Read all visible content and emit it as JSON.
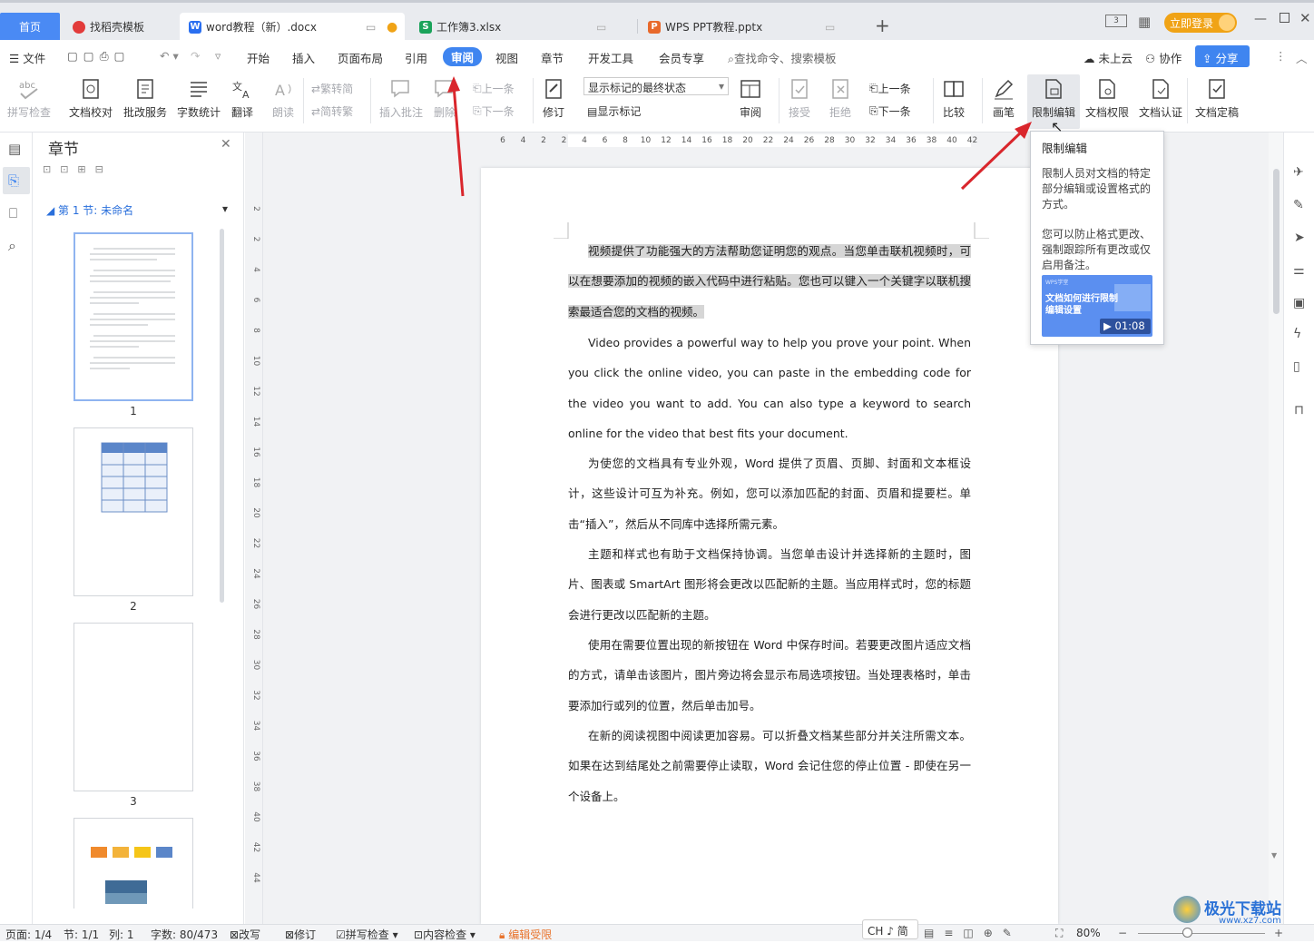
{
  "tabs": {
    "home": "首页",
    "t1": "找稻壳模板",
    "t2": "word教程（新）.docx",
    "t3": "工作簿3.xlsx",
    "t4": "WPS PPT教程.pptx",
    "login": "立即登录"
  },
  "menu": {
    "file": "文件",
    "items": [
      "开始",
      "插入",
      "页面布局",
      "引用",
      "审阅",
      "视图",
      "章节",
      "开发工具",
      "会员专享"
    ],
    "search": "查找命令、搜索模板",
    "cloud": "未上云",
    "collab": "协作",
    "share": "分享"
  },
  "ribbon": {
    "spell": "拼写检查",
    "proof": "文档校对",
    "batch": "批改服务",
    "wordcount": "字数统计",
    "translate": "翻译",
    "read": "朗读",
    "trad": "繁转简",
    "simp": "简转繁",
    "insert_comment": "插入批注",
    "delete": "删除",
    "prev": "上一条",
    "next": "下一条",
    "track": "修订",
    "markup_select": "显示标记的最终状态",
    "show_markup": "显示标记",
    "review": "审阅",
    "accept": "接受",
    "reject": "拒绝",
    "prev2": "上一条",
    "next2": "下一条",
    "compare": "比较",
    "pen": "画笔",
    "restrict": "限制编辑",
    "permission": "文档权限",
    "certify": "文档认证",
    "finalize": "文档定稿"
  },
  "nav": {
    "title": "章节",
    "section": "第 1 节: 未命名",
    "pages": [
      "1",
      "2",
      "3"
    ]
  },
  "ruler": [
    "6",
    "4",
    "2",
    "2",
    "4",
    "6",
    "8",
    "10",
    "12",
    "14",
    "16",
    "18",
    "20",
    "22",
    "24",
    "26",
    "28",
    "30",
    "32",
    "34",
    "36",
    "38",
    "40",
    "42"
  ],
  "vruler": [
    "2",
    "2",
    "4",
    "6",
    "8",
    "10",
    "12",
    "14",
    "16",
    "18",
    "20",
    "22",
    "24",
    "26",
    "28",
    "30",
    "32",
    "34",
    "36",
    "38",
    "40",
    "42",
    "44"
  ],
  "doc": {
    "p1": "视频提供了功能强大的方法帮助您证明您的观点。当您单击联机视频时，可以在想要添加的视频的嵌入代码中进行粘贴。您也可以键入一个关键字以联机搜索最适合您的文档的视频。",
    "p2": "Video provides a powerful way to help you prove your point. When you click the online video, you can paste in the embedding code for the video you want to add. You can also type a keyword to search online for the video that best fits your document.",
    "p3": "为使您的文档具有专业外观，Word 提供了页眉、页脚、封面和文本框设计，这些设计可互为补充。例如，您可以添加匹配的封面、页眉和提要栏。单击“插入”，然后从不同库中选择所需元素。",
    "p4": "主题和样式也有助于文档保持协调。当您单击设计并选择新的主题时，图片、图表或 SmartArt 图形将会更改以匹配新的主题。当应用样式时，您的标题会进行更改以匹配新的主题。",
    "p5": "使用在需要位置出现的新按钮在 Word 中保存时间。若要更改图片适应文档的方式，请单击该图片，图片旁边将会显示布局选项按钮。当处理表格时，单击要添加行或列的位置，然后单击加号。",
    "p6": "在新的阅读视图中阅读更加容易。可以折叠文档某些部分并关注所需文本。如果在达到结尾处之前需要停止读取，Word 会记住您的停止位置 - 即使在另一个设备上。"
  },
  "tooltip": {
    "title": "限制编辑",
    "desc1": "限制人员对文档的特定部分编辑或设置格式的方式。",
    "desc2": "您可以防止格式更改、强制跟踪所有更改或仅启用备注。",
    "brand": "WPS学堂",
    "video_title": "文档如何进行限制编辑设置",
    "duration": "01:08"
  },
  "status": {
    "page": "页面: 1/4",
    "section": "节: 1/1",
    "col": "列: 1",
    "words": "字数: 80/473",
    "overtype": "改写",
    "track": "修订",
    "spell": "拼写检查",
    "content": "内容检查",
    "restricted": "编辑受限",
    "ime": "CH ♪ 简",
    "zoom": "80%"
  },
  "watermark": {
    "site": "极光下载站",
    "url": "www.xz7.com"
  },
  "colors": {
    "accent": "#3f85f0",
    "login": "#f0a316",
    "restricted": "#e8732c"
  }
}
